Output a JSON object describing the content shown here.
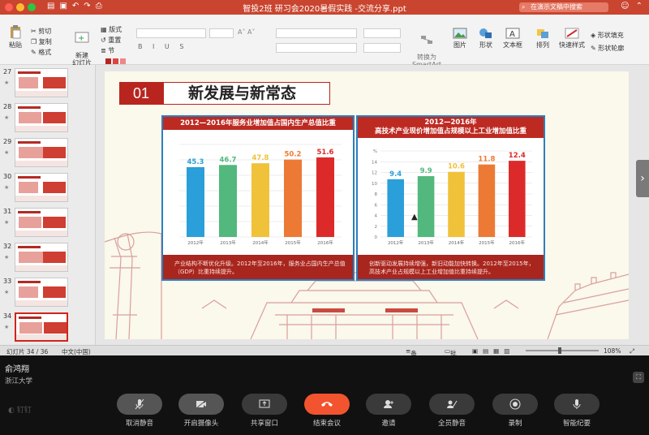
{
  "window": {
    "title": "智投2班 研习会2020暑假实践 -交流分享.ppt",
    "search_placeholder": "在演示文稿中搜索"
  },
  "ribbon": {
    "paste": "粘贴",
    "cut": "剪切",
    "copy": "复制",
    "format": "格式",
    "new_slide": "新建\n幻灯片",
    "layout": "版式",
    "reset": "重置",
    "section": "节",
    "convert_smartart": "转换为\nSmartArt",
    "picture": "图片",
    "shapes": "形状",
    "textbox": "文本框",
    "arrange": "排列",
    "quick_styles": "快速样式",
    "shape_fill": "形状填充",
    "shape_outline": "形状轮廓"
  },
  "sidebar": {
    "thumbnails": [
      {
        "num": "27",
        "active": false
      },
      {
        "num": "28",
        "active": false
      },
      {
        "num": "29",
        "active": false
      },
      {
        "num": "30",
        "active": false
      },
      {
        "num": "31",
        "active": false
      },
      {
        "num": "32",
        "active": false
      },
      {
        "num": "33",
        "active": false
      },
      {
        "num": "34",
        "active": true
      }
    ]
  },
  "slide": {
    "number": "01",
    "title": "新发展与新常态",
    "left_panel": {
      "heading": "2012—2016年服务业增加值占国内生产总值比重",
      "footer": "产业结构不断优化升级。2012年至2016年，服务业占国内生产总值（GDP）比重持续提升。"
    },
    "right_panel": {
      "heading": "2012—2016年\n高技术产业现价增加值占规模以上工业增加值比重",
      "footer": "创新驱动发展持续增强，新旧动能加快转换。2012年至2015年，高技术产业占规模以上工业增加值比重持续提升。"
    }
  },
  "chart_data": [
    {
      "type": "bar",
      "title": "2012—2016年服务业增加值占国内生产总值比重",
      "categories": [
        "2012年",
        "2013年",
        "2014年",
        "2015年",
        "2016年"
      ],
      "values": [
        45.3,
        46.7,
        47.8,
        50.2,
        51.6
      ],
      "colors": [
        "#2b9fd9",
        "#52b87d",
        "#f0c23a",
        "#ec7a35",
        "#dc2a2a"
      ],
      "ylim": [
        0,
        60
      ],
      "grid": true
    },
    {
      "type": "bar",
      "title": "2012—2016年高技术产业现价增加值占规模以上工业增加值比重",
      "categories": [
        "2012年",
        "2013年",
        "2014年",
        "2015年",
        "2016年"
      ],
      "values": [
        9.4,
        9.9,
        10.6,
        11.8,
        12.4
      ],
      "colors": [
        "#2b9fd9",
        "#52b87d",
        "#f0c23a",
        "#ec7a35",
        "#dc2a2a"
      ],
      "yticks": [
        "%",
        "14",
        "12",
        "10",
        "8",
        "6",
        "4",
        "2",
        "0"
      ],
      "ylim": [
        0,
        14
      ],
      "grid": true
    }
  ],
  "statusbar": {
    "slide_info": "幻灯片 34 / 36",
    "language": "中文(中国)",
    "notes": "备注",
    "comments": "批注",
    "zoom": "108%"
  },
  "meeting": {
    "presenter_name": "俞鸿翔",
    "presenter_org": "浙江大学",
    "brand": "钉钉",
    "controls": [
      {
        "label": "取消静音",
        "icon": "mic-icon"
      },
      {
        "label": "开启摄像头",
        "icon": "camera-icon"
      },
      {
        "label": "共享窗口",
        "icon": "share-icon"
      },
      {
        "label": "结束会议",
        "icon": "hangup-icon"
      },
      {
        "label": "邀请",
        "icon": "invite-icon"
      },
      {
        "label": "全员静音",
        "icon": "mute-all-icon"
      },
      {
        "label": "录制",
        "icon": "record-icon"
      },
      {
        "label": "智能纪要",
        "icon": "notes-icon"
      }
    ]
  },
  "colors": {
    "titlebar": "#c9452f",
    "slide_red": "#b8251f",
    "panel_border": "#2c7fc0",
    "end_meeting": "#f2542f"
  }
}
